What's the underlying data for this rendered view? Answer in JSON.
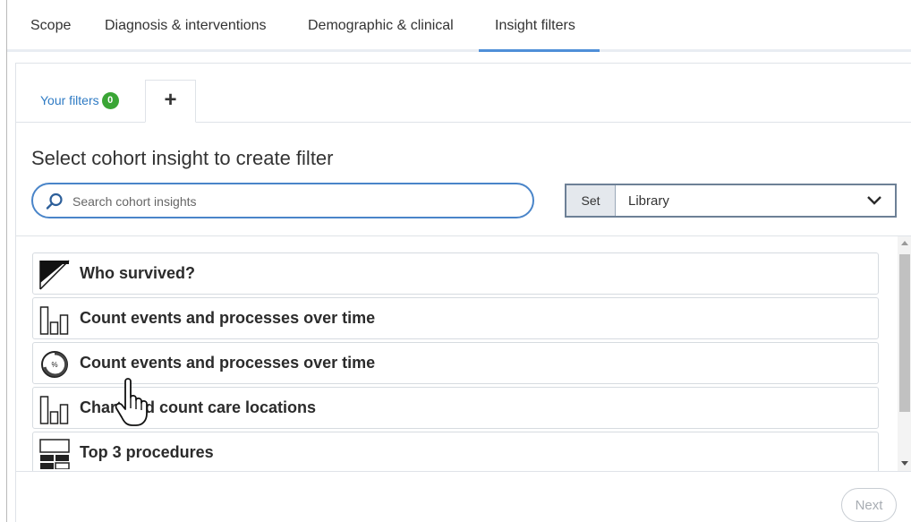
{
  "top_tabs": [
    {
      "label": "Scope"
    },
    {
      "label": "Diagnosis & interventions"
    },
    {
      "label": "Demographic & clinical"
    },
    {
      "label": "Insight filters",
      "active": true
    }
  ],
  "sub_tabs": {
    "your_filters_label": "Your filters",
    "your_filters_count": "0",
    "add_label": "+"
  },
  "heading": "Select cohort insight to create filter",
  "search": {
    "placeholder": "Search cohort insights",
    "value": ""
  },
  "set_select": {
    "label": "Set",
    "value": "Library"
  },
  "insights": [
    {
      "label": "Who survived?",
      "icon": "survival-curve-icon"
    },
    {
      "label": "Count events and processes over time",
      "icon": "bar-chart-icon"
    },
    {
      "label": "Count events and processes over time",
      "icon": "percent-ring-icon"
    },
    {
      "label": "Chart and count care locations",
      "icon": "bar-chart-icon"
    },
    {
      "label": "Top 3 procedures",
      "icon": "table-layout-icon"
    }
  ],
  "next_label": "Next",
  "colors": {
    "accent": "#4f8fd8",
    "badge": "#3aa535",
    "link": "#2f7bc4"
  }
}
